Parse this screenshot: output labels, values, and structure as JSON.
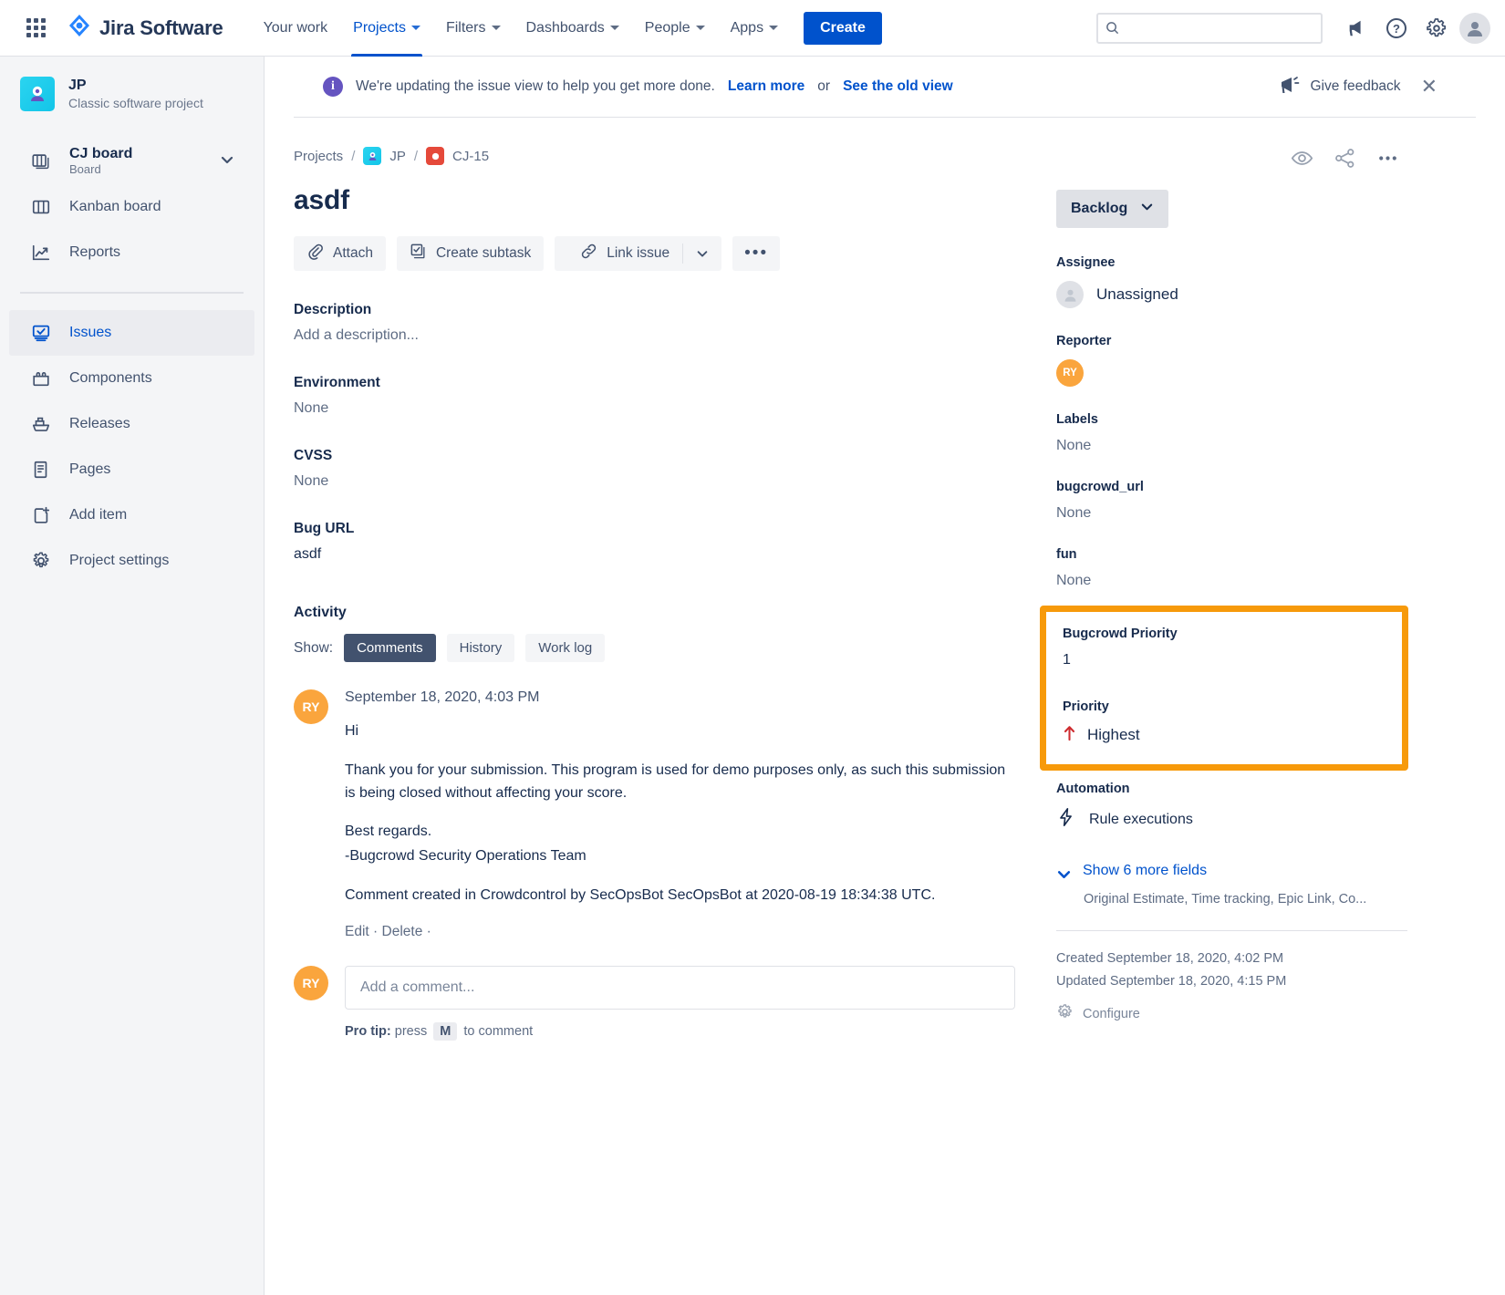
{
  "topnav": {
    "app_switcher_icon": "grid-apps-icon",
    "brand": "Jira Software",
    "items": [
      {
        "label": "Your work",
        "has_caret": false,
        "active": false
      },
      {
        "label": "Projects",
        "has_caret": true,
        "active": true
      },
      {
        "label": "Filters",
        "has_caret": true,
        "active": false
      },
      {
        "label": "Dashboards",
        "has_caret": true,
        "active": false
      },
      {
        "label": "People",
        "has_caret": true,
        "active": false
      },
      {
        "label": "Apps",
        "has_caret": true,
        "active": false
      }
    ],
    "create_label": "Create",
    "search_value": "",
    "search_placeholder": "",
    "icons": [
      "search-icon",
      "notifications-icon",
      "help-icon",
      "settings-gear-icon",
      "profile-avatar-icon"
    ]
  },
  "sidebar": {
    "project": {
      "key": "JP",
      "subtitle": "Classic software project",
      "avatar_icon": "project-robot-icon"
    },
    "boards": [
      {
        "label": "CJ board",
        "sublabel": "Board",
        "icon": "board-stack-icon",
        "caret": true
      },
      {
        "label": "Kanban board",
        "sublabel": "",
        "icon": "board-columns-icon",
        "caret": false
      },
      {
        "label": "Reports",
        "sublabel": "",
        "icon": "reports-chart-icon",
        "caret": false
      }
    ],
    "items": [
      {
        "label": "Issues",
        "icon": "issues-check-icon",
        "selected": true
      },
      {
        "label": "Components",
        "icon": "components-icon",
        "selected": false
      },
      {
        "label": "Releases",
        "icon": "releases-ship-icon",
        "selected": false
      },
      {
        "label": "Pages",
        "icon": "pages-doc-icon",
        "selected": false
      },
      {
        "label": "Add item",
        "icon": "add-item-icon",
        "selected": false
      },
      {
        "label": "Project settings",
        "icon": "settings-gear-icon",
        "selected": false
      }
    ]
  },
  "banner": {
    "info_icon": "info-icon",
    "text": "We're updating the issue view to help you get more done.",
    "learn_more": "Learn more",
    "or": "or",
    "old_view": "See the old view",
    "feedback_label": "Give feedback",
    "feedback_icon": "megaphone-icon",
    "close_icon": "close-icon"
  },
  "breadcrumb": {
    "projects": "Projects",
    "project_key": "JP",
    "issue_key": "CJ-15",
    "sep": "/"
  },
  "issue": {
    "title": "asdf",
    "actions": [
      {
        "label": "Attach",
        "icon": "paperclip-icon"
      },
      {
        "label": "Create subtask",
        "icon": "subtask-icon"
      },
      {
        "label": "Link issue",
        "icon": "link-icon",
        "split": true
      },
      {
        "label": "•••",
        "icon": "more-icon"
      }
    ],
    "fields": [
      {
        "label": "Description",
        "value": "Add a description...",
        "muted": true
      },
      {
        "label": "Environment",
        "value": "None",
        "muted": true
      },
      {
        "label": "CVSS",
        "value": "None",
        "muted": true
      },
      {
        "label": "Bug URL",
        "value": "asdf",
        "muted": false
      }
    ]
  },
  "activity": {
    "title": "Activity",
    "show_label": "Show:",
    "tabs": [
      {
        "label": "Comments",
        "active": true
      },
      {
        "label": "History",
        "active": false
      },
      {
        "label": "Work log",
        "active": false
      }
    ],
    "comment": {
      "avatar_initials": "RY",
      "date": "September 18, 2020, 4:03 PM",
      "paragraphs": [
        "Hi",
        "Thank you for your submission. This program is used for demo purposes only, as such this submission is being closed without affecting your score.",
        "Best regards.",
        "-Bugcrowd Security Operations Team",
        "Comment created in Crowdcontrol by SecOpsBot SecOpsBot at 2020-08-19 18:34:38 UTC."
      ],
      "edit": "Edit",
      "dot1": "·",
      "delete": "Delete",
      "dot2": "·"
    },
    "composer": {
      "avatar_initials": "RY",
      "placeholder": "Add a comment...",
      "value": "",
      "protip_bold": "Pro tip:",
      "protip_pre": "press",
      "protip_key": "M",
      "protip_post": "to comment"
    }
  },
  "rightpanel": {
    "top_icons": [
      "watch-eye-icon",
      "share-icon",
      "more-actions-icon"
    ],
    "status": {
      "label": "Backlog",
      "caret_icon": "chevron-down-icon"
    },
    "assignee": {
      "label": "Assignee",
      "value": "Unassigned",
      "avatar_icon": "user-placeholder-icon"
    },
    "reporter": {
      "label": "Reporter",
      "avatar_initials": "RY"
    },
    "labels": {
      "label": "Labels",
      "value": "None"
    },
    "bugcrowd_url": {
      "label": "bugcrowd_url",
      "value": "None"
    },
    "fun": {
      "label": "fun",
      "value": "None"
    },
    "highlighted": {
      "bugcrowd_priority": {
        "label": "Bugcrowd Priority",
        "value": "1"
      },
      "priority": {
        "label": "Priority",
        "value": "Highest",
        "icon": "arrow-up-highest-icon"
      },
      "border_color": "#F79A0A"
    },
    "automation": {
      "label": "Automation",
      "value": "Rule executions",
      "icon": "lightning-bolt-icon"
    },
    "show_more": {
      "label": "Show 6 more fields",
      "caret_icon": "chevron-down-icon",
      "sub": "Original Estimate, Time tracking, Epic Link, Co..."
    },
    "created": "Created September 18, 2020, 4:02 PM",
    "updated": "Updated September 18, 2020, 4:15 PM",
    "configure": {
      "label": "Configure",
      "icon": "configure-gear-icon"
    }
  }
}
